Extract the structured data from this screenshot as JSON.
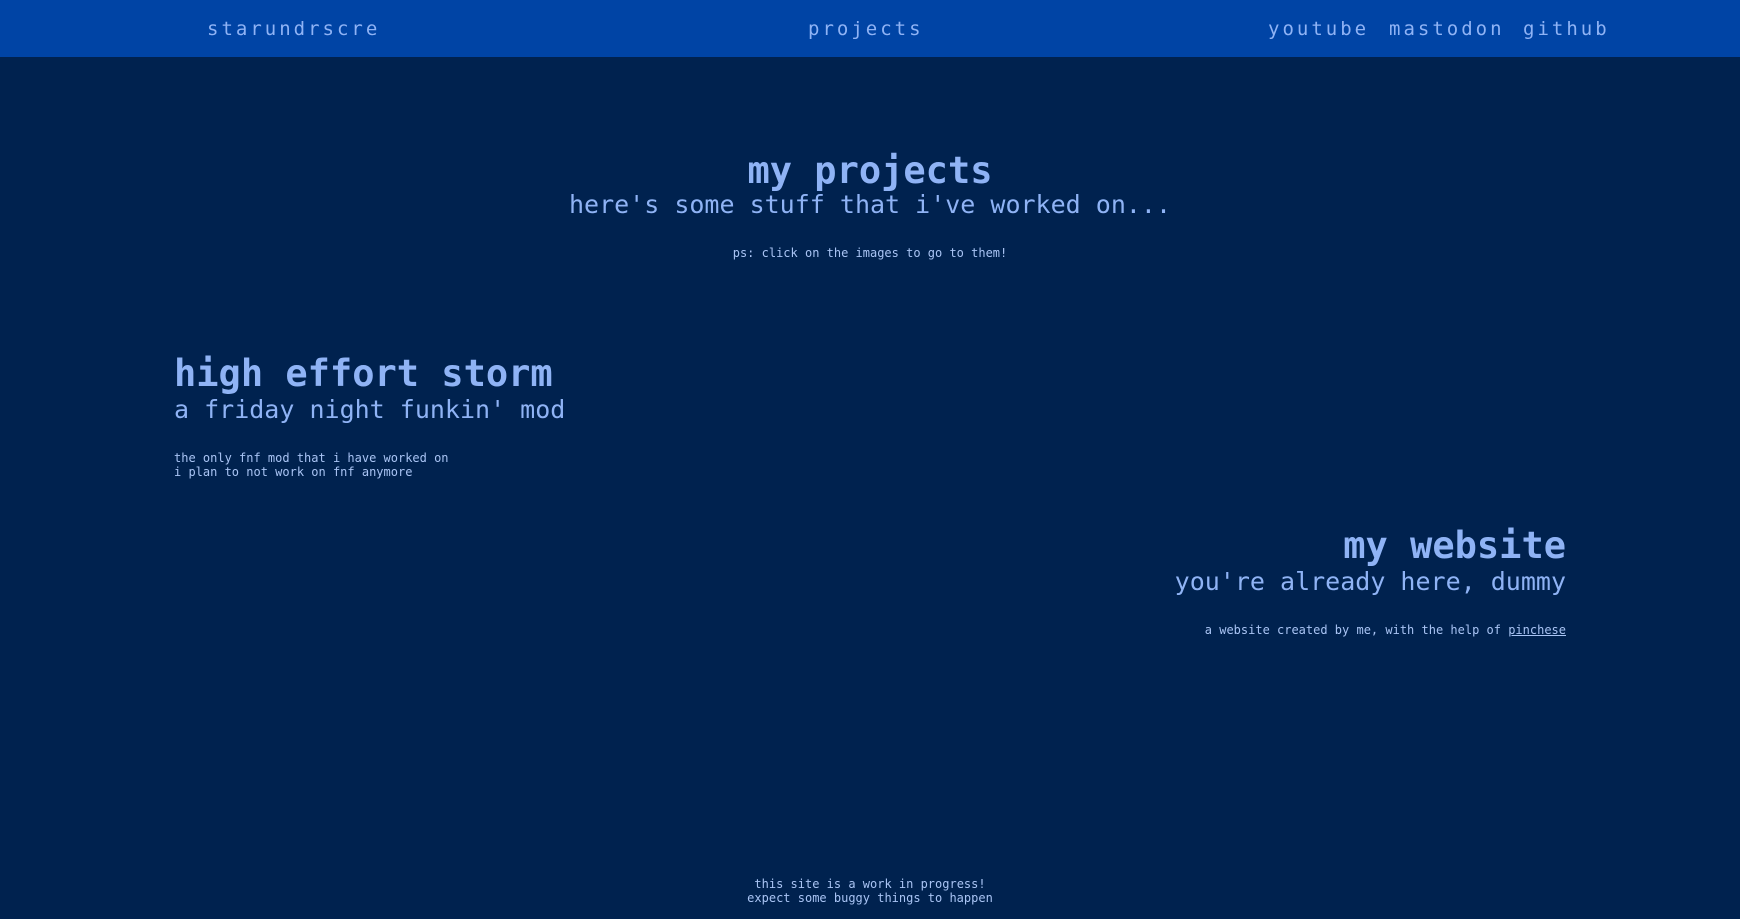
{
  "nav": {
    "brand": "starundrscre",
    "center_link": "projects",
    "right_links": [
      "youtube",
      "mastodon",
      "github"
    ]
  },
  "hero": {
    "title": "my projects",
    "subtitle": "here's some stuff that i've worked on...",
    "note": "ps: click on the images to go to them!"
  },
  "projects": [
    {
      "title": "high effort storm",
      "subtitle": "a friday night funkin' mod",
      "description_lines": [
        "the only fnf mod that i have worked on",
        "i plan to not work on fnf anymore"
      ]
    },
    {
      "title": "my website",
      "subtitle": "you're already here, dummy",
      "description_prefix": "a website created by me, with the help of ",
      "description_link": "pinchese"
    }
  ],
  "footer": {
    "lines": [
      "this site is a work in progress!",
      "expect some buggy things to happen"
    ]
  },
  "colors": {
    "background": "#00224f",
    "navbar": "#0044a5",
    "text": "#8fb3f5"
  }
}
